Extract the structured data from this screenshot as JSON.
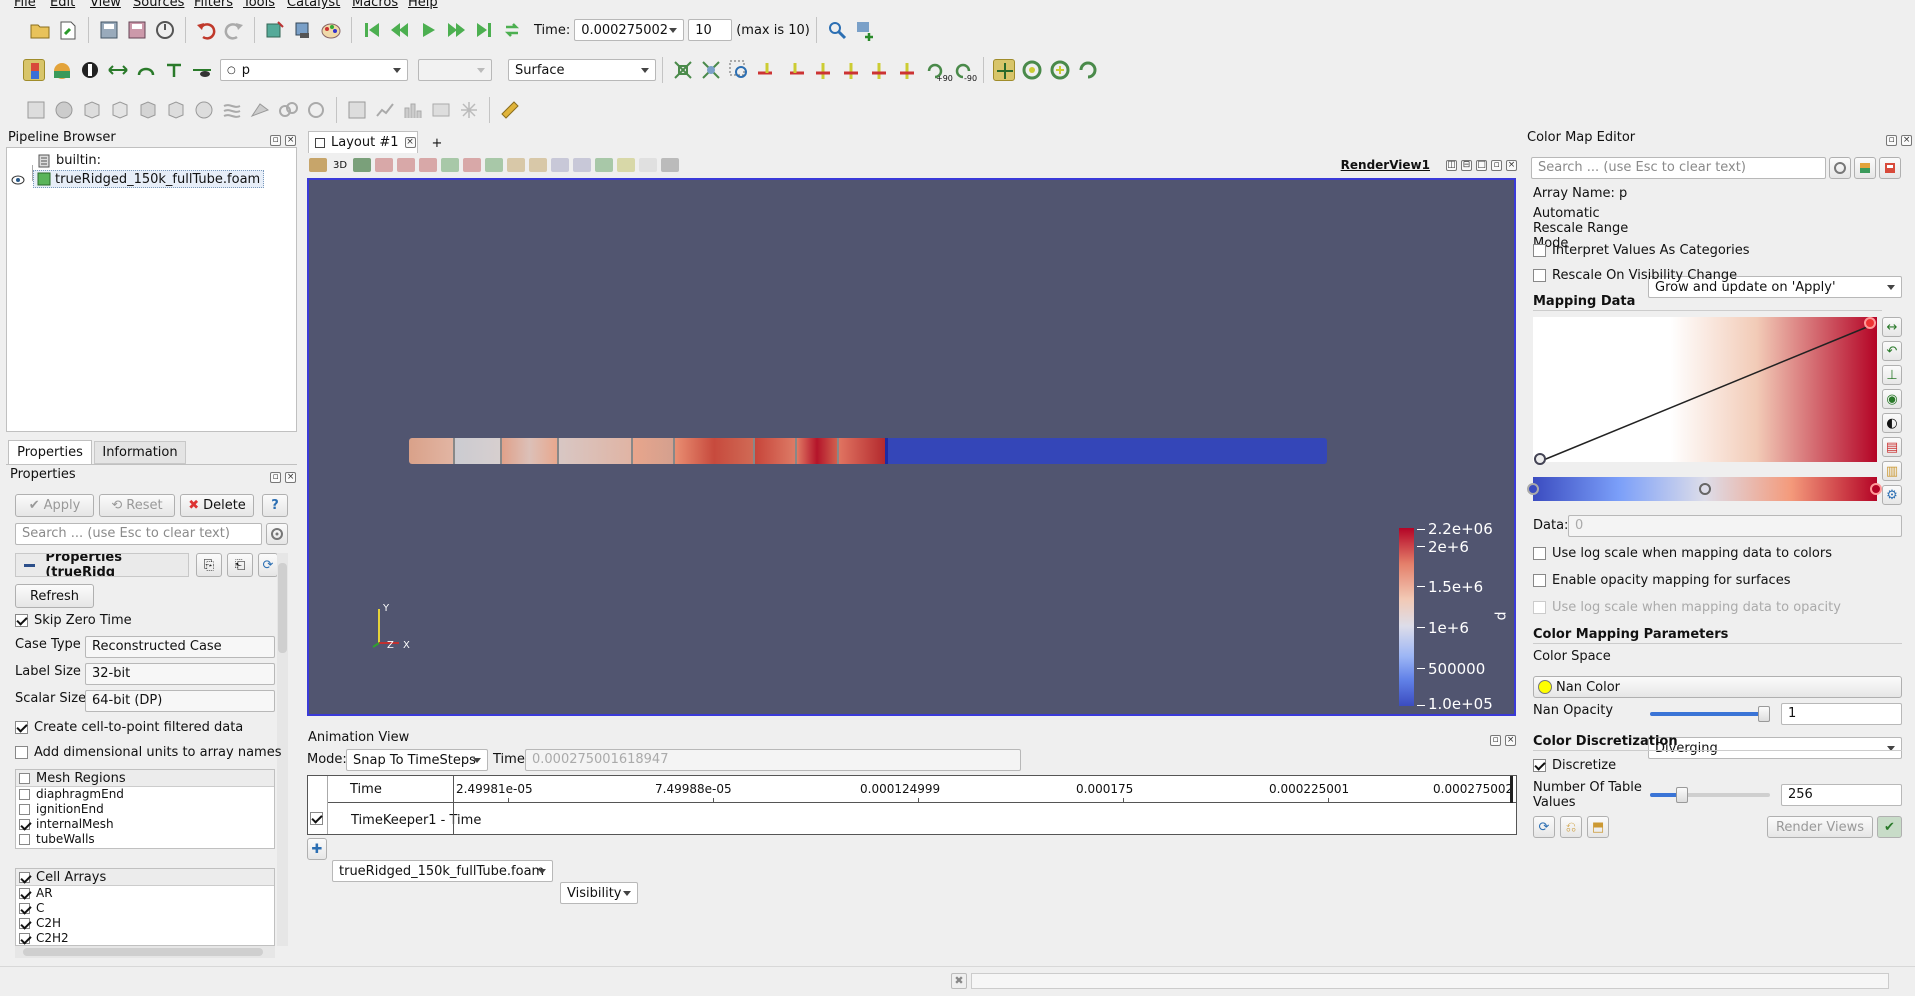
{
  "menu": [
    "File",
    "Edit",
    "View",
    "Sources",
    "Filters",
    "Tools",
    "Catalyst",
    "Macros",
    "Help"
  ],
  "toolbar": {
    "time_label": "Time:",
    "time_value": "0.000275002",
    "step_value": "10",
    "max_label": "(max is 10)",
    "array_selector": "p",
    "representation": "Surface",
    "rot_plus90": "+90",
    "rot_minus90": "-90"
  },
  "pipeline": {
    "title": "Pipeline Browser",
    "root": "builtin:",
    "source": "trueRidged_150k_fullTube.foam"
  },
  "properties": {
    "tab_properties": "Properties",
    "tab_information": "Information",
    "title": "Properties",
    "apply": "Apply",
    "reset": "Reset",
    "delete": "Delete",
    "help": "?",
    "search_placeholder": "Search ... (use Esc to clear text)",
    "section_title": "Properties (trueRidg",
    "refresh": "Refresh",
    "skip_zero_time": "Skip Zero Time",
    "case_type_label": "Case Type",
    "case_type_value": "Reconstructed Case",
    "label_size_label": "Label Size",
    "label_size_value": "32-bit",
    "scalar_size_label": "Scalar Size",
    "scalar_size_value": "64-bit (DP)",
    "cell_to_point": "Create cell-to-point filtered data",
    "dim_units": "Add dimensional units to array names",
    "mesh_regions_header": "Mesh Regions",
    "mesh_regions": [
      {
        "name": "diaphragmEnd",
        "checked": false
      },
      {
        "name": "ignitionEnd",
        "checked": false
      },
      {
        "name": "internalMesh",
        "checked": true
      },
      {
        "name": "tubeWalls",
        "checked": false
      }
    ],
    "cell_arrays_header": "Cell Arrays",
    "cell_arrays": [
      {
        "name": "AR",
        "checked": true
      },
      {
        "name": "C",
        "checked": true
      },
      {
        "name": "C2H",
        "checked": true
      },
      {
        "name": "C2H2",
        "checked": true
      }
    ]
  },
  "layout": {
    "tab": "Layout #1",
    "add_tab": "+",
    "label_3d": "3D",
    "view_name": "RenderView1"
  },
  "render": {
    "background": "#515570",
    "colorbar_title": "p",
    "colorbar_ticks": [
      "2.2e+06",
      "2e+6",
      "1.5e+6",
      "1e+6",
      "500000",
      "1.0e+05"
    ],
    "axes": {
      "y": "Y",
      "z": "Z",
      "x": "X"
    }
  },
  "animation": {
    "title": "Animation View",
    "mode_label": "Mode:",
    "mode_value": "Snap To TimeSteps",
    "time_label": "Time",
    "time_value": "0.000275001618947",
    "time_row_label": "Time",
    "ticks": [
      "2.49981e-05",
      "7.49988e-05",
      "0.000124999",
      "0.000175",
      "0.000225001",
      "0.000275002"
    ],
    "track_label": "TimeKeeper1 - Time",
    "source_select": "trueRidged_150k_fullTube.foam",
    "property_select": "Visibility"
  },
  "colormap": {
    "title": "Color Map Editor",
    "search_placeholder": "Search ... (use Esc to clear text)",
    "array_name": "Array Name: p",
    "auto_rescale_label": "Automatic Rescale Range Mode",
    "auto_rescale_value": "Grow and update on 'Apply'",
    "interpret_categories": "Interpret Values As Categories",
    "rescale_visibility": "Rescale On Visibility Change",
    "mapping_data": "Mapping Data",
    "data_label": "Data:",
    "data_value": "0",
    "log_colors": "Use log scale when mapping data to colors",
    "opacity_mapping": "Enable opacity mapping for surfaces",
    "log_opacity": "Use log scale when mapping data to opacity",
    "params_header": "Color Mapping Parameters",
    "color_space_label": "Color Space",
    "color_space_value": "Diverging",
    "nan_color": "Nan Color",
    "nan_opacity_label": "Nan Opacity",
    "nan_opacity_value": "1",
    "discretization_header": "Color Discretization",
    "discretize": "Discretize",
    "table_values_label": "Number Of Table Values",
    "table_values_value": "256",
    "render_views": "Render Views"
  }
}
